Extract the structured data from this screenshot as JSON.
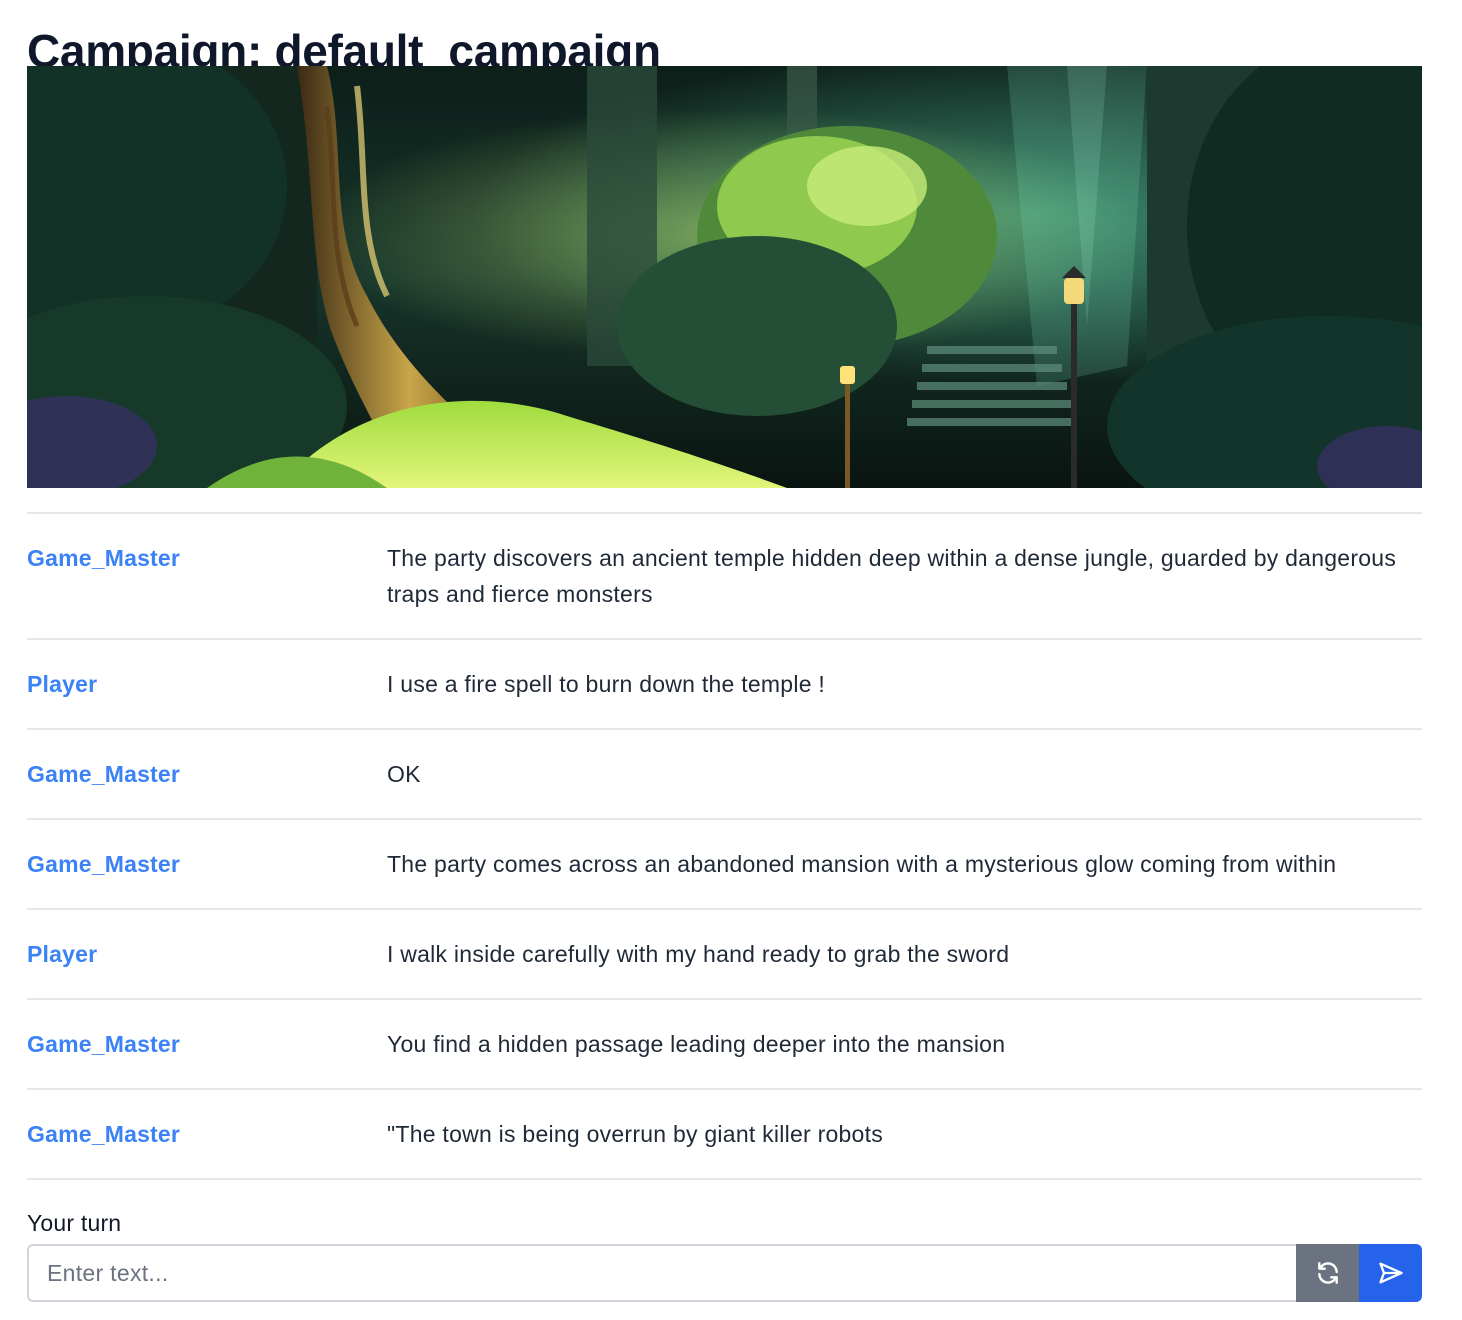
{
  "page": {
    "title": "Campaign: default_campaign"
  },
  "banner": {
    "alt": "Fantasy forest illustration with a twisted tree, lanterns and stone steps"
  },
  "messages": [
    {
      "speaker": "Game_Master",
      "text": "The party discovers an ancient temple hidden deep within a dense jungle, guarded by dangerous traps and fierce monsters"
    },
    {
      "speaker": "Player",
      "text": "I use a fire spell to burn down the temple !"
    },
    {
      "speaker": "Game_Master",
      "text": "OK"
    },
    {
      "speaker": "Game_Master",
      "text": "The party comes across an abandoned mansion with a mysterious glow coming from within"
    },
    {
      "speaker": "Player",
      "text": "I walk inside carefully with my hand ready to grab the sword"
    },
    {
      "speaker": "Game_Master",
      "text": "You find a hidden passage leading deeper into the mansion"
    },
    {
      "speaker": "Game_Master",
      "text": "\"The town is being overrun by giant killer robots"
    }
  ],
  "composer": {
    "label": "Your turn",
    "placeholder": "Enter text...",
    "value": "",
    "refresh_icon": "refresh-icon",
    "send_icon": "send-icon"
  },
  "colors": {
    "speaker": "#3b82f6",
    "refresh_button": "#6b7280",
    "send_button": "#2563eb",
    "divider": "#e5e7eb"
  }
}
